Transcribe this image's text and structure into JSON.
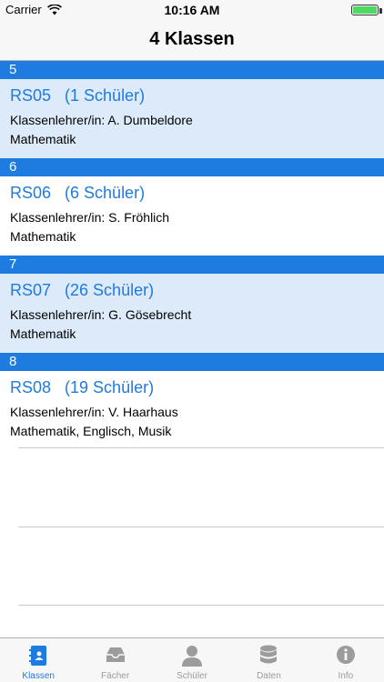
{
  "status": {
    "carrier": "Carrier",
    "time": "10:16 AM"
  },
  "nav": {
    "title": "4 Klassen"
  },
  "sections": [
    {
      "header": "5",
      "title": "RS05   (1 Schüler)",
      "teacher": "Klassenlehrer/in: A. Dumbeldore",
      "subjects": "Mathematik"
    },
    {
      "header": "6",
      "title": "RS06   (6 Schüler)",
      "teacher": "Klassenlehrer/in: S. Fröhlich",
      "subjects": "Mathematik"
    },
    {
      "header": "7",
      "title": "RS07   (26 Schüler)",
      "teacher": "Klassenlehrer/in: G. Gösebrecht",
      "subjects": "Mathematik"
    },
    {
      "header": "8",
      "title": "RS08   (19 Schüler)",
      "teacher": "Klassenlehrer/in: V. Haarhaus",
      "subjects": "Mathematik, Englisch, Musik"
    }
  ],
  "tabs": [
    {
      "label": "Klassen",
      "icon": "contacts-book-icon",
      "active": true
    },
    {
      "label": "Fächer",
      "icon": "tray-icon",
      "active": false
    },
    {
      "label": "Schüler",
      "icon": "person-icon",
      "active": false
    },
    {
      "label": "Daten",
      "icon": "database-icon",
      "active": false
    },
    {
      "label": "Info",
      "icon": "info-icon",
      "active": false
    }
  ],
  "colors": {
    "accent": "#1e7be0",
    "row_alt": "#dceaf9",
    "inactive": "#9c9c9c"
  }
}
